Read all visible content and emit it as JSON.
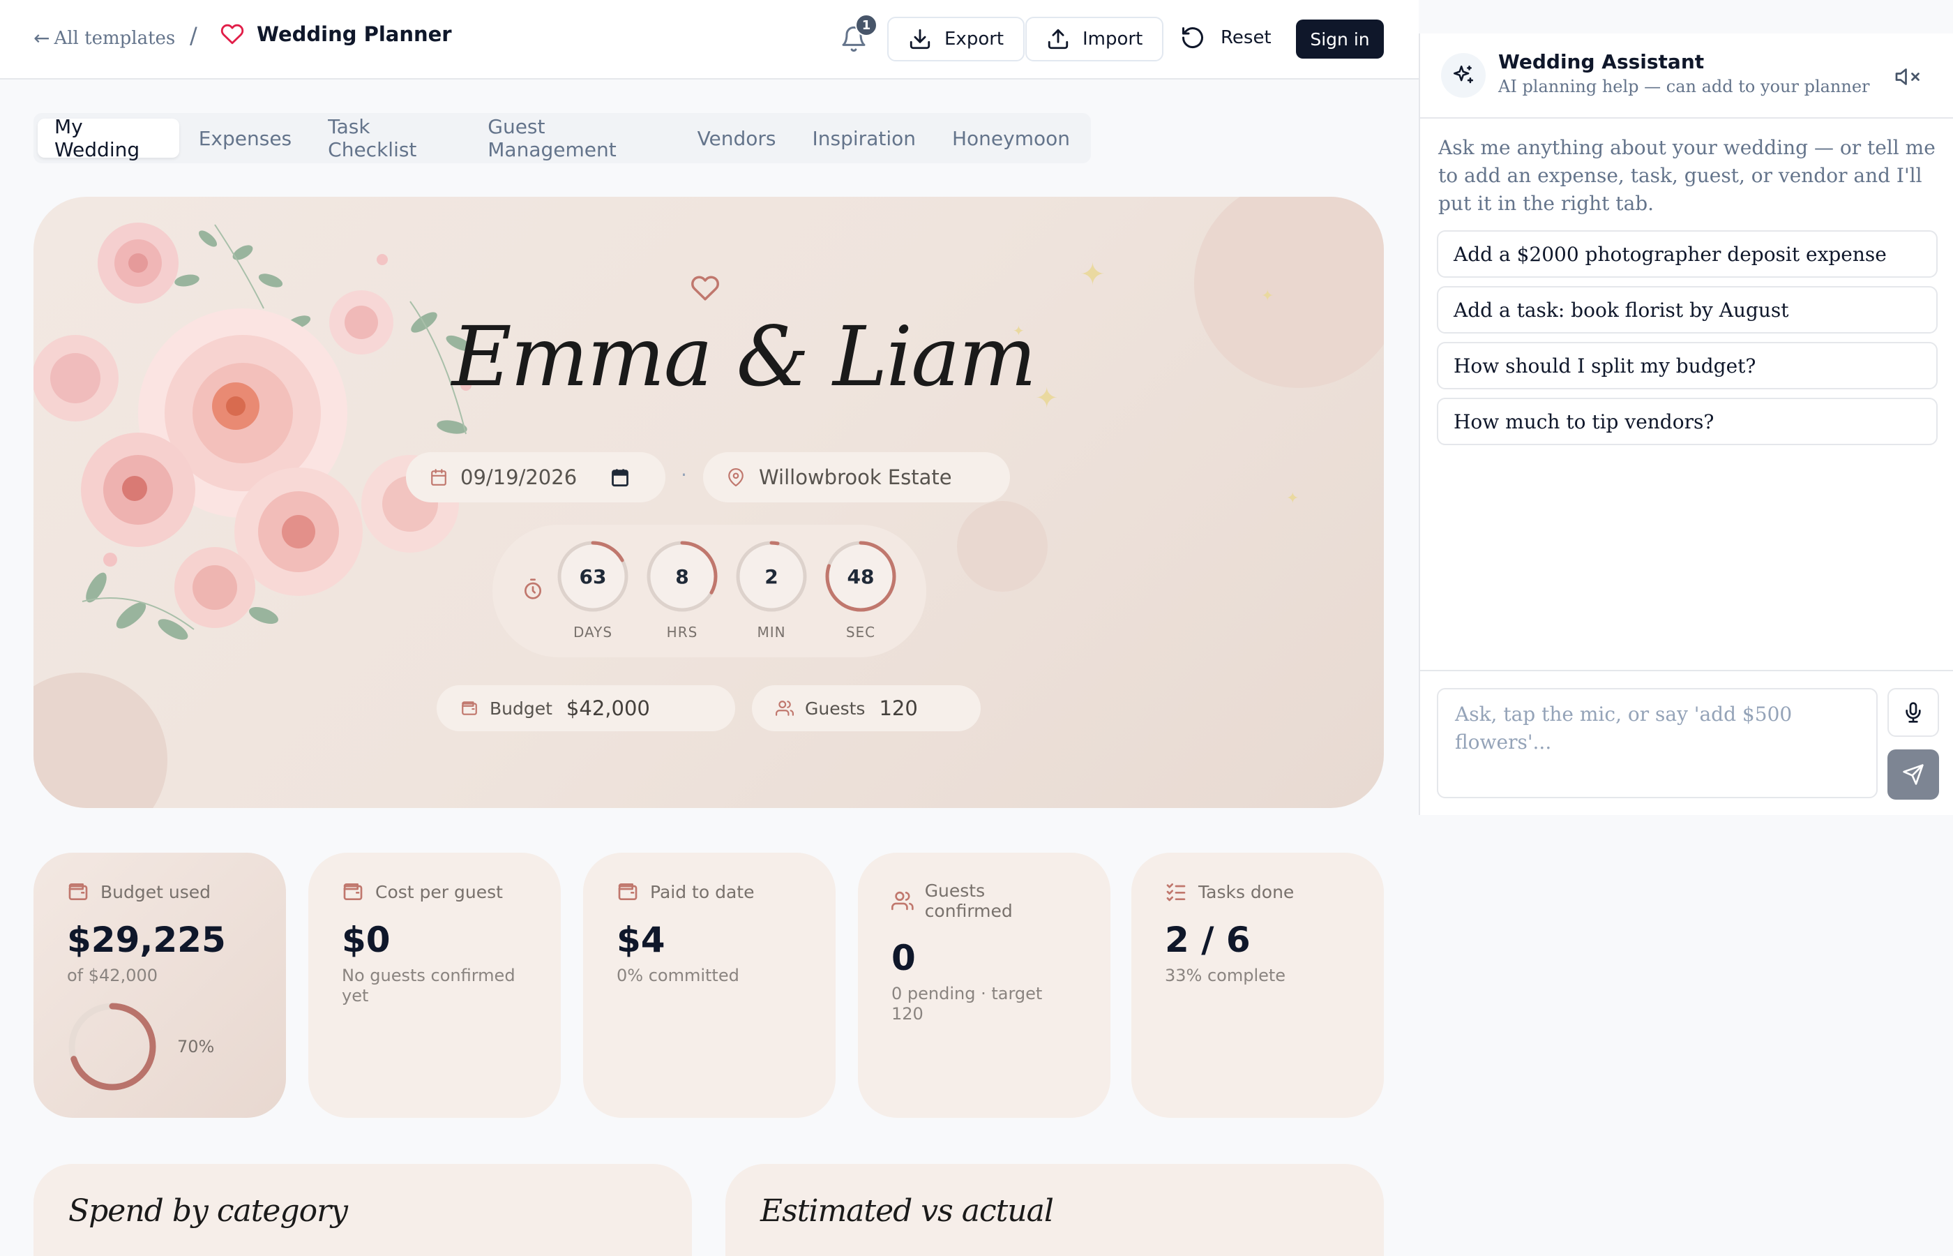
{
  "header": {
    "back_arrow": "←",
    "back_label": "All templates",
    "separator": "/",
    "app_title": "Wedding Planner",
    "notification_count": "1",
    "export_label": "Export",
    "import_label": "Import",
    "reset_label": "Reset",
    "signin_label": "Sign in"
  },
  "tabs": [
    {
      "label": "My Wedding",
      "active": true
    },
    {
      "label": "Expenses"
    },
    {
      "label": "Task Checklist"
    },
    {
      "label": "Guest Management"
    },
    {
      "label": "Vendors"
    },
    {
      "label": "Inspiration"
    },
    {
      "label": "Honeymoon"
    }
  ],
  "hero": {
    "couple": "Emma & Liam",
    "date": "09/19/2026",
    "dot": "·",
    "venue": "Willowbrook Estate",
    "countdown": [
      {
        "value": "63",
        "label": "DAYS",
        "fraction": 0.17
      },
      {
        "value": "8",
        "label": "HRS",
        "fraction": 0.33
      },
      {
        "value": "2",
        "label": "MIN",
        "fraction": 0.03
      },
      {
        "value": "48",
        "label": "SEC",
        "fraction": 0.8
      }
    ],
    "budget_label": "Budget",
    "budget_value": "$42,000",
    "guests_label": "Guests",
    "guests_value": "120"
  },
  "stats": [
    {
      "label": "Budget used",
      "value": "$29,225",
      "sub": "of $42,000",
      "progress": 0.7,
      "progress_label": "70%"
    },
    {
      "label": "Cost per guest",
      "value": "$0",
      "sub": "No guests confirmed yet"
    },
    {
      "label": "Paid to date",
      "value": "$4",
      "sub": "0% committed"
    },
    {
      "label": "Guests confirmed",
      "value": "0",
      "sub": "0 pending · target 120"
    },
    {
      "label": "Tasks done",
      "value": "2 / 6",
      "sub": "33% complete"
    }
  ],
  "panels": {
    "spend_title": "Spend by category",
    "estimate_title": "Estimated vs actual"
  },
  "assistant": {
    "title": "Wedding Assistant",
    "subtitle": "AI planning help — can add to your planner",
    "intro": "Ask me anything about your wedding — or tell me to add an expense, task, guest, or vendor and I'll put it in the right tab.",
    "suggestions": [
      "Add a $2000 photographer deposit expense",
      "Add a task: book florist by August",
      "How should I split my budget?",
      "How much to tip vendors?"
    ],
    "placeholder": "Ask, tap the mic, or say 'add $500 flowers'..."
  },
  "colors": {
    "accent": "#c0776d",
    "brand_dark": "#0f172a",
    "hero_bg": "#efe4dd",
    "card_bg": "#f6eee9",
    "heart": "#e11d48"
  }
}
